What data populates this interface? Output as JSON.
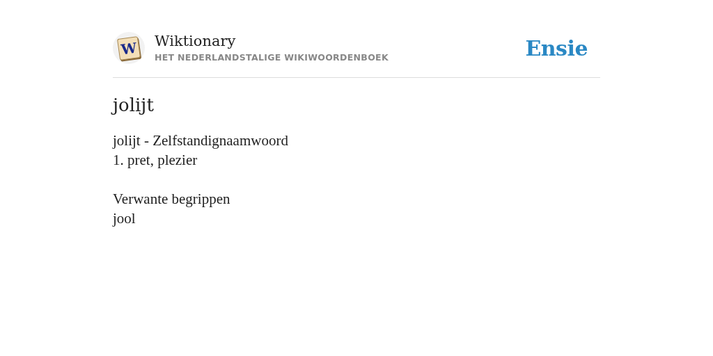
{
  "header": {
    "logo_letter": "W",
    "site_title": "Wiktionary",
    "site_subtitle": "HET NEDERLANDSTALIGE WIKIWOORDENBOEK",
    "brand": "Ensie"
  },
  "page_title": "jolijt",
  "sections": [
    {
      "lines": [
        "jolijt - Zelfstandignaamwoord",
        "1. pret, plezier"
      ]
    },
    {
      "lines": [
        "Verwante begrippen",
        "jool"
      ]
    }
  ]
}
